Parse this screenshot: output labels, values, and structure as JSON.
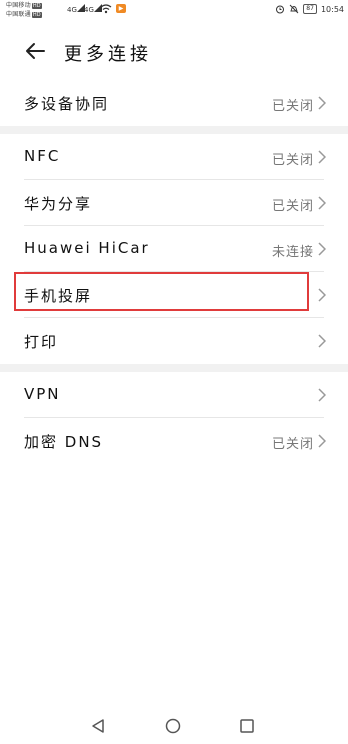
{
  "status_bar": {
    "carrier1": "中国移动",
    "carrier2": "中国联通",
    "hd_label": "HD",
    "signal1": "4G",
    "signal2": "4G",
    "play_label": "▶",
    "battery": "87",
    "time": "10:54"
  },
  "header": {
    "title": "更多连接"
  },
  "groups": [
    {
      "items": [
        {
          "label": "多设备协同",
          "status": "已关闭"
        }
      ]
    },
    {
      "items": [
        {
          "label": "NFC",
          "status": "已关闭"
        },
        {
          "label": "华为分享",
          "status": "已关闭"
        },
        {
          "label": "Huawei HiCar",
          "status": "未连接"
        },
        {
          "label": "手机投屏",
          "status": ""
        },
        {
          "label": "打印",
          "status": ""
        }
      ]
    },
    {
      "items": [
        {
          "label": "VPN",
          "status": ""
        },
        {
          "label": "加密 DNS",
          "status": "已关闭"
        }
      ]
    }
  ],
  "colors": {
    "highlight": "#e03b3b",
    "separator": "#f1f1f1",
    "status_text": "#777777"
  },
  "navbar": {
    "icons": [
      "back-triangle-icon",
      "home-circle-icon",
      "recents-square-icon"
    ]
  }
}
